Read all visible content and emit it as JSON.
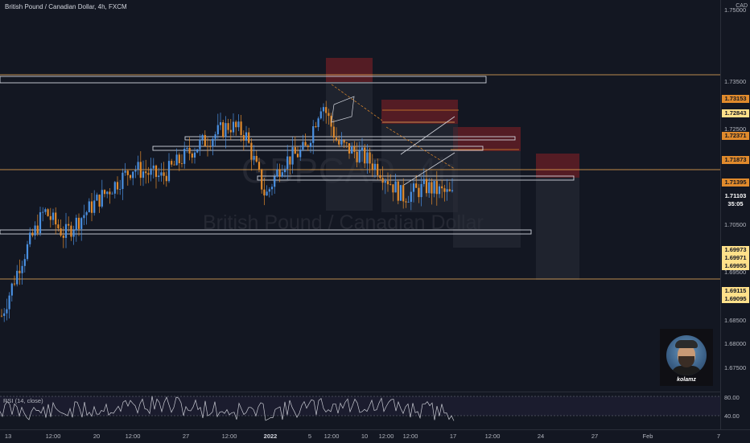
{
  "header": {
    "symbol_title": "British Pound / Canadian Dollar, 4h, FXCM"
  },
  "watermark": {
    "symbol": "GBPCAD, 4h",
    "name": "British Pound / Canadian Dollar"
  },
  "price_axis": {
    "currency": "CAD",
    "ticks": [
      {
        "label": "1.75000",
        "value": 1.75
      },
      {
        "label": "1.73500",
        "value": 1.735
      },
      {
        "label": "1.72500",
        "value": 1.725
      },
      {
        "label": "1.70500",
        "value": 1.705
      },
      {
        "label": "1.69500",
        "value": 1.695
      },
      {
        "label": "1.68500",
        "value": 1.685
      },
      {
        "label": "1.68000",
        "value": 1.68
      },
      {
        "label": "1.67500",
        "value": 1.675
      }
    ],
    "tags": [
      {
        "label": "1.73153",
        "value": 1.73153,
        "color": "#e08a2c"
      },
      {
        "label": "1.72843",
        "value": 1.72843,
        "color": "#ffe08a"
      },
      {
        "label": "1.72371",
        "value": 1.72371,
        "color": "#e08a2c"
      },
      {
        "label": "1.71873",
        "value": 1.71873,
        "color": "#e08a2c"
      },
      {
        "label": "1.71395",
        "value": 1.71395,
        "color": "#e08a2c"
      },
      {
        "label": "1.71103",
        "value": 1.71103,
        "color": "#131722"
      },
      {
        "label": "35:05",
        "value": 1.71103,
        "color": "#131722"
      },
      {
        "label": "1.69973",
        "value": 1.69973,
        "color": "#ffe08a"
      },
      {
        "label": "1.69971",
        "value": 1.69971,
        "color": "#ffe08a"
      },
      {
        "label": "1.69955",
        "value": 1.69955,
        "color": "#ffe08a"
      },
      {
        "label": "1.69115",
        "value": 1.69115,
        "color": "#ffe08a"
      },
      {
        "label": "1.69095",
        "value": 1.69095,
        "color": "#ffe08a"
      }
    ]
  },
  "rsi": {
    "label": "RSI (14, close)",
    "upper": "80.00",
    "lower": "40.00"
  },
  "time_axis": {
    "ticks": [
      "13",
      "12:00",
      "20",
      "12:00",
      "27",
      "12:00",
      "2022",
      "5",
      "12:00",
      "10",
      "12:00",
      "12:00",
      "17",
      "12:00",
      "24",
      "27",
      "Feb",
      "7"
    ]
  },
  "avatar": {
    "name": "kolamz"
  },
  "colors": {
    "background": "#131722",
    "bull": "#4a90e2",
    "bear": "#e08a2c",
    "level_line": "#f5b35c",
    "zone_red": "#8b2027"
  }
}
